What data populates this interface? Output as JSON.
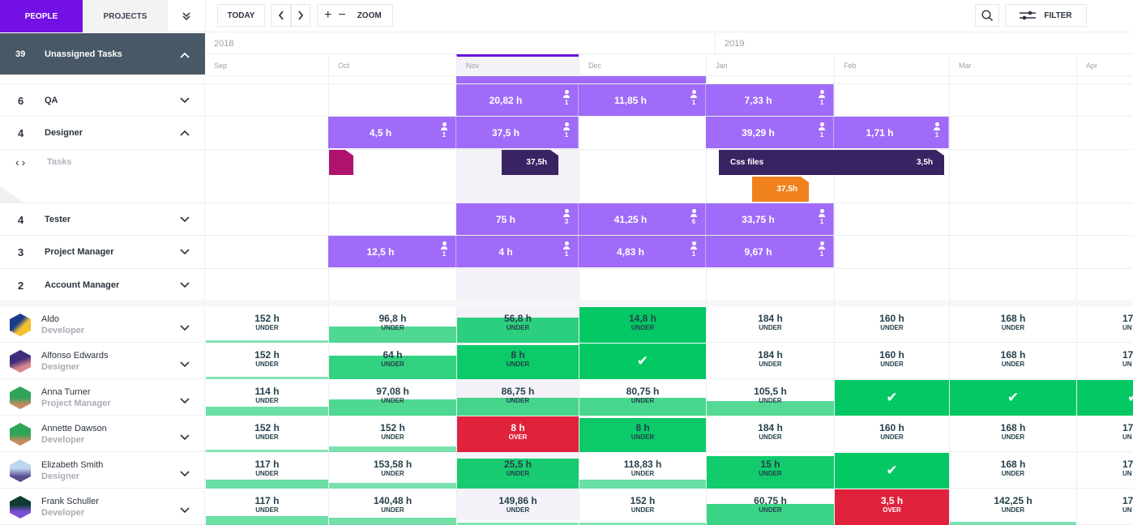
{
  "toolbar": {
    "tab_people": "PEOPLE",
    "tab_projects": "PROJECTS",
    "today": "TODAY",
    "zoom": "ZOOM",
    "filter": "FILTER",
    "colors": {
      "accent": "#7311e4",
      "allocation": "#a06bf8",
      "under": "#04c864",
      "over": "#e0223d"
    }
  },
  "unassigned": {
    "count": "39",
    "label": "Unassigned Tasks"
  },
  "timeline": {
    "years": [
      "2018",
      "2019"
    ],
    "months": [
      "Sep",
      "Oct",
      "Nov",
      "Dec",
      "Jan",
      "Feb",
      "Mar",
      "Apr"
    ],
    "current_month": "Nov"
  },
  "roles": [
    {
      "count": "6",
      "name": "QA",
      "expanded": false,
      "allocations": [
        {
          "month": "Nov",
          "hours": "20,82 h",
          "people": "1"
        },
        {
          "month": "Dec",
          "hours": "11,85 h",
          "people": "1"
        },
        {
          "month": "Jan",
          "hours": "7,33 h",
          "people": "1"
        }
      ]
    },
    {
      "count": "4",
      "name": "Designer",
      "expanded": true,
      "allocations": [
        {
          "month": "Oct",
          "hours": "4,5 h",
          "people": "1"
        },
        {
          "month": "Nov",
          "hours": "37,5 h",
          "people": "1"
        },
        {
          "month": "Jan",
          "hours": "39,29 h",
          "people": "1"
        },
        {
          "month": "Feb",
          "hours": "1,71 h",
          "people": "1"
        }
      ]
    },
    {
      "count": "4",
      "name": "Tester",
      "expanded": false,
      "allocations": [
        {
          "month": "Nov",
          "hours": "75 h",
          "people": "3"
        },
        {
          "month": "Dec",
          "hours": "41,25 h",
          "people": "6"
        },
        {
          "month": "Jan",
          "hours": "33,75 h",
          "people": "1"
        }
      ]
    },
    {
      "count": "3",
      "name": "Project Manager",
      "expanded": false,
      "allocations": [
        {
          "month": "Oct",
          "hours": "12,5 h",
          "people": "1"
        },
        {
          "month": "Nov",
          "hours": "4 h",
          "people": "1"
        },
        {
          "month": "Dec",
          "hours": "4,83 h",
          "people": "1"
        },
        {
          "month": "Jan",
          "hours": "9,67 h",
          "people": "1"
        }
      ]
    },
    {
      "count": "2",
      "name": "Account Manager",
      "expanded": false,
      "allocations": []
    }
  ],
  "tasks_row": {
    "label": "Tasks",
    "tasks": [
      {
        "name": "",
        "hours": "",
        "color": "#b0136f"
      },
      {
        "name": "",
        "hours": "37,5h",
        "color": "#392463"
      },
      {
        "name": "Css files",
        "hours": "3,5h",
        "color": "#392463"
      },
      {
        "name": "",
        "hours": "37,5h",
        "color": "#f0821e"
      }
    ]
  },
  "people": [
    {
      "name": "Aldo",
      "role": "Developer",
      "cells": [
        {
          "hours": "152 h",
          "status": "UNDER",
          "fill": 0.05
        },
        {
          "hours": "96,8 h",
          "status": "UNDER",
          "fill": 0.45
        },
        {
          "hours": "56,8 h",
          "status": "UNDER",
          "fill": 0.7
        },
        {
          "hours": "14,8 h",
          "status": "UNDER",
          "fill": 1.0
        },
        {
          "hours": "184 h",
          "status": "UNDER",
          "fill": 0
        },
        {
          "hours": "160 h",
          "status": "UNDER",
          "fill": 0
        },
        {
          "hours": "168 h",
          "status": "UNDER",
          "fill": 0
        },
        {
          "hours": "17",
          "status": "UN",
          "fill": 0
        }
      ]
    },
    {
      "name": "Alfonso Edwards",
      "role": "Designer",
      "cells": [
        {
          "hours": "152 h",
          "status": "UNDER",
          "fill": 0.05
        },
        {
          "hours": "64 h",
          "status": "UNDER",
          "fill": 0.65
        },
        {
          "hours": "8 h",
          "status": "UNDER",
          "fill": 0.95
        },
        {
          "hours": "",
          "status": "FULL",
          "fill": 1.0
        },
        {
          "hours": "184 h",
          "status": "UNDER",
          "fill": 0
        },
        {
          "hours": "160 h",
          "status": "UNDER",
          "fill": 0
        },
        {
          "hours": "168 h",
          "status": "UNDER",
          "fill": 0
        },
        {
          "hours": "17",
          "status": "UN",
          "fill": 0
        }
      ]
    },
    {
      "name": "Anna Turner",
      "role": "Project Manager",
      "cells": [
        {
          "hours": "114 h",
          "status": "UNDER",
          "fill": 0.25
        },
        {
          "hours": "97,08 h",
          "status": "UNDER",
          "fill": 0.45
        },
        {
          "hours": "86,75 h",
          "status": "UNDER",
          "fill": 0.5
        },
        {
          "hours": "80,75 h",
          "status": "UNDER",
          "fill": 0.5
        },
        {
          "hours": "105,5 h",
          "status": "UNDER",
          "fill": 0.42
        },
        {
          "hours": "",
          "status": "FULL",
          "fill": 1.0
        },
        {
          "hours": "",
          "status": "FULL",
          "fill": 1.0
        },
        {
          "hours": "",
          "status": "FULL",
          "fill": 1.0
        }
      ]
    },
    {
      "name": "Annette Dawson",
      "role": "Developer",
      "cells": [
        {
          "hours": "152 h",
          "status": "UNDER",
          "fill": 0.05
        },
        {
          "hours": "152 h",
          "status": "UNDER",
          "fill": 0.15
        },
        {
          "hours": "8 h",
          "status": "OVER",
          "fill": 1.0
        },
        {
          "hours": "8 h",
          "status": "UNDER",
          "fill": 0.95
        },
        {
          "hours": "184 h",
          "status": "UNDER",
          "fill": 0
        },
        {
          "hours": "160 h",
          "status": "UNDER",
          "fill": 0
        },
        {
          "hours": "168 h",
          "status": "UNDER",
          "fill": 0
        },
        {
          "hours": "17",
          "status": "UN",
          "fill": 0
        }
      ]
    },
    {
      "name": "Elizabeth Smith",
      "role": "Designer",
      "cells": [
        {
          "hours": "117 h",
          "status": "UNDER",
          "fill": 0.25
        },
        {
          "hours": "153,58 h",
          "status": "UNDER",
          "fill": 0.15
        },
        {
          "hours": "25,5 h",
          "status": "UNDER",
          "fill": 0.85
        },
        {
          "hours": "118,83 h",
          "status": "UNDER",
          "fill": 0.25
        },
        {
          "hours": "15 h",
          "status": "UNDER",
          "fill": 0.9
        },
        {
          "hours": "",
          "status": "FULL",
          "fill": 1.0
        },
        {
          "hours": "168 h",
          "status": "UNDER",
          "fill": 0
        },
        {
          "hours": "17",
          "status": "UN",
          "fill": 0
        }
      ]
    },
    {
      "name": "Frank Schuller",
      "role": "Developer",
      "cells": [
        {
          "hours": "117 h",
          "status": "UNDER",
          "fill": 0.25
        },
        {
          "hours": "140,48 h",
          "status": "UNDER",
          "fill": 0.2
        },
        {
          "hours": "149,86 h",
          "status": "UNDER",
          "fill": 0.05
        },
        {
          "hours": "152 h",
          "status": "UNDER",
          "fill": 0.05
        },
        {
          "hours": "60,75 h",
          "status": "UNDER",
          "fill": 0.6
        },
        {
          "hours": "3,5 h",
          "status": "OVER",
          "fill": 1.0
        },
        {
          "hours": "142,25 h",
          "status": "UNDER",
          "fill": 0.1
        },
        {
          "hours": "17",
          "status": "UN",
          "fill": 0
        }
      ]
    }
  ]
}
